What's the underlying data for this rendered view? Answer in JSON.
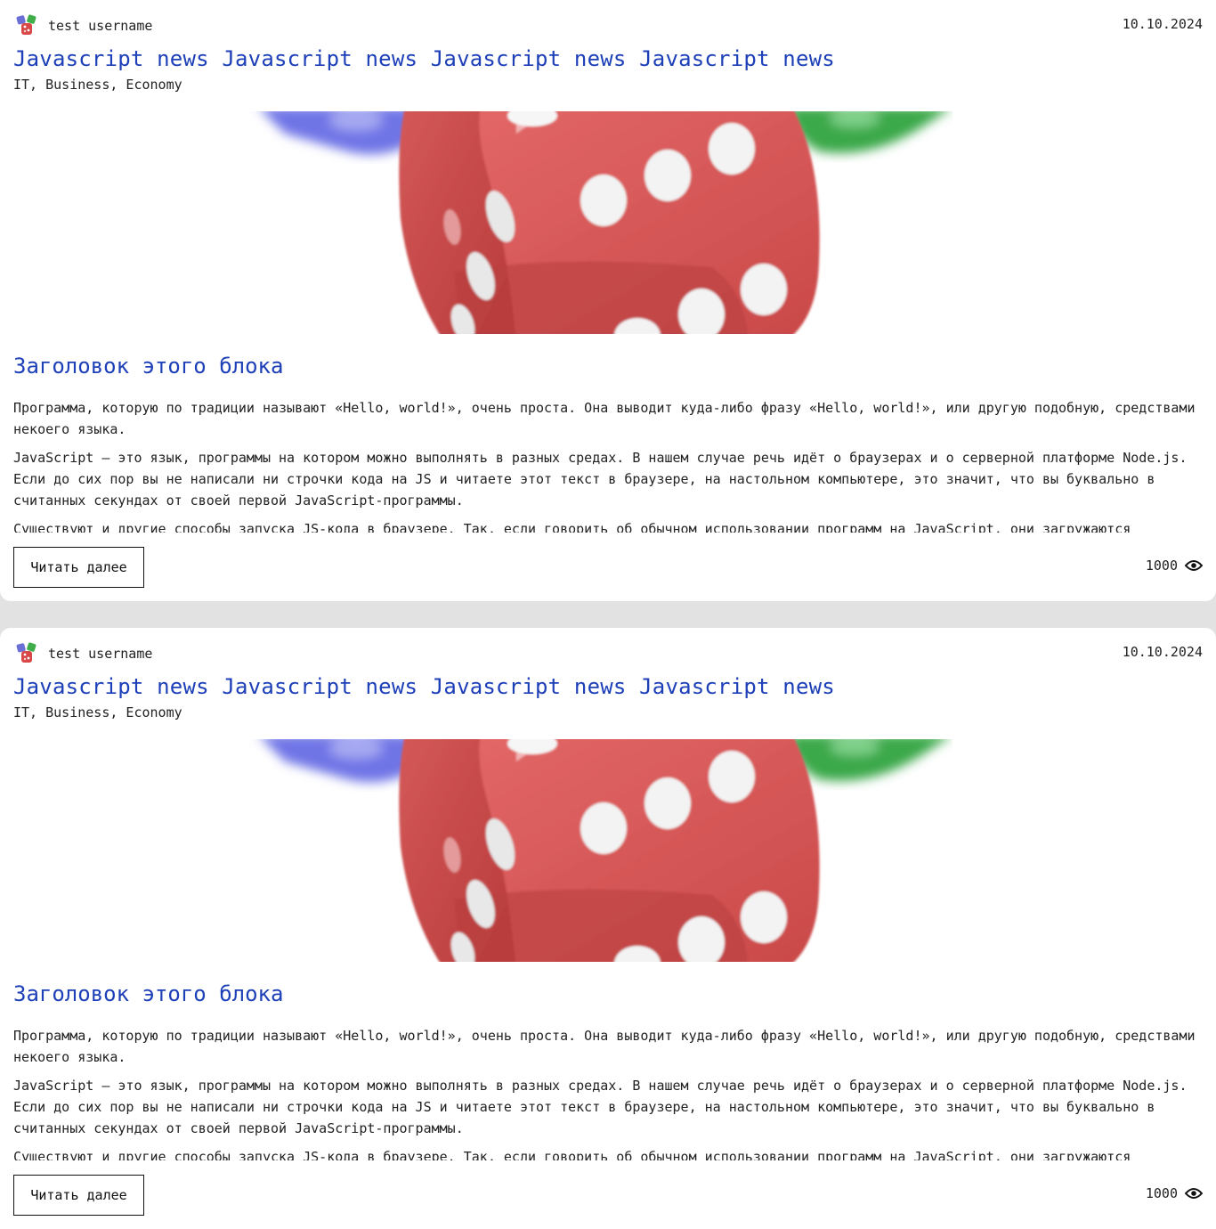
{
  "colors": {
    "accent": "#1d3fb8",
    "page_background": "#e2e2e2",
    "card_background": "#ffffff"
  },
  "posts": [
    {
      "author": "test username",
      "avatar_icon": "dice-avatar-icon",
      "date": "10.10.2024",
      "title": "Javascript news Javascript news Javascript news Javascript news",
      "tags": "IT, Business, Economy",
      "image_icon": "dice-image",
      "block_title": "Заголовок этого блока",
      "paragraphs": [
        "Программа, которую по традиции называют «Hello, world!», очень проста. Она выводит куда-либо фразу «Hello, world!», или другую подобную, средствами некоего языка.",
        "JavaScript — это язык, программы на котором можно выполнять в разных средах. В нашем случае речь идёт о браузерах и о серверной платформе Node.js. Если до сих пор вы не написали ни строчки кода на JS и читаете этот текст в браузере, на настольном компьютере, это значит, что вы буквально в считанных секундах от своей первой JavaScript-программы.",
        "Существуют и другие способы запуска JS-кода в браузере. Так, если говорить об обычном использовании программ на JavaScript, они загружаются"
      ],
      "read_more_label": "Читать далее",
      "views": "1000",
      "views_icon": "eye-icon"
    },
    {
      "author": "test username",
      "avatar_icon": "dice-avatar-icon",
      "date": "10.10.2024",
      "title": "Javascript news Javascript news Javascript news Javascript news",
      "tags": "IT, Business, Economy",
      "image_icon": "dice-image",
      "block_title": "Заголовок этого блока",
      "paragraphs": [
        "Программа, которую по традиции называют «Hello, world!», очень проста. Она выводит куда-либо фразу «Hello, world!», или другую подобную, средствами некоего языка.",
        "JavaScript — это язык, программы на котором можно выполнять в разных средах. В нашем случае речь идёт о браузерах и о серверной платформе Node.js. Если до сих пор вы не написали ни строчки кода на JS и читаете этот текст в браузере, на настольном компьютере, это значит, что вы буквально в считанных секундах от своей первой JavaScript-программы.",
        "Существуют и другие способы запуска JS-кода в браузере. Так, если говорить об обычном использовании программ на JavaScript, они загружаются"
      ],
      "read_more_label": "Читать далее",
      "views": "1000",
      "views_icon": "eye-icon"
    }
  ]
}
